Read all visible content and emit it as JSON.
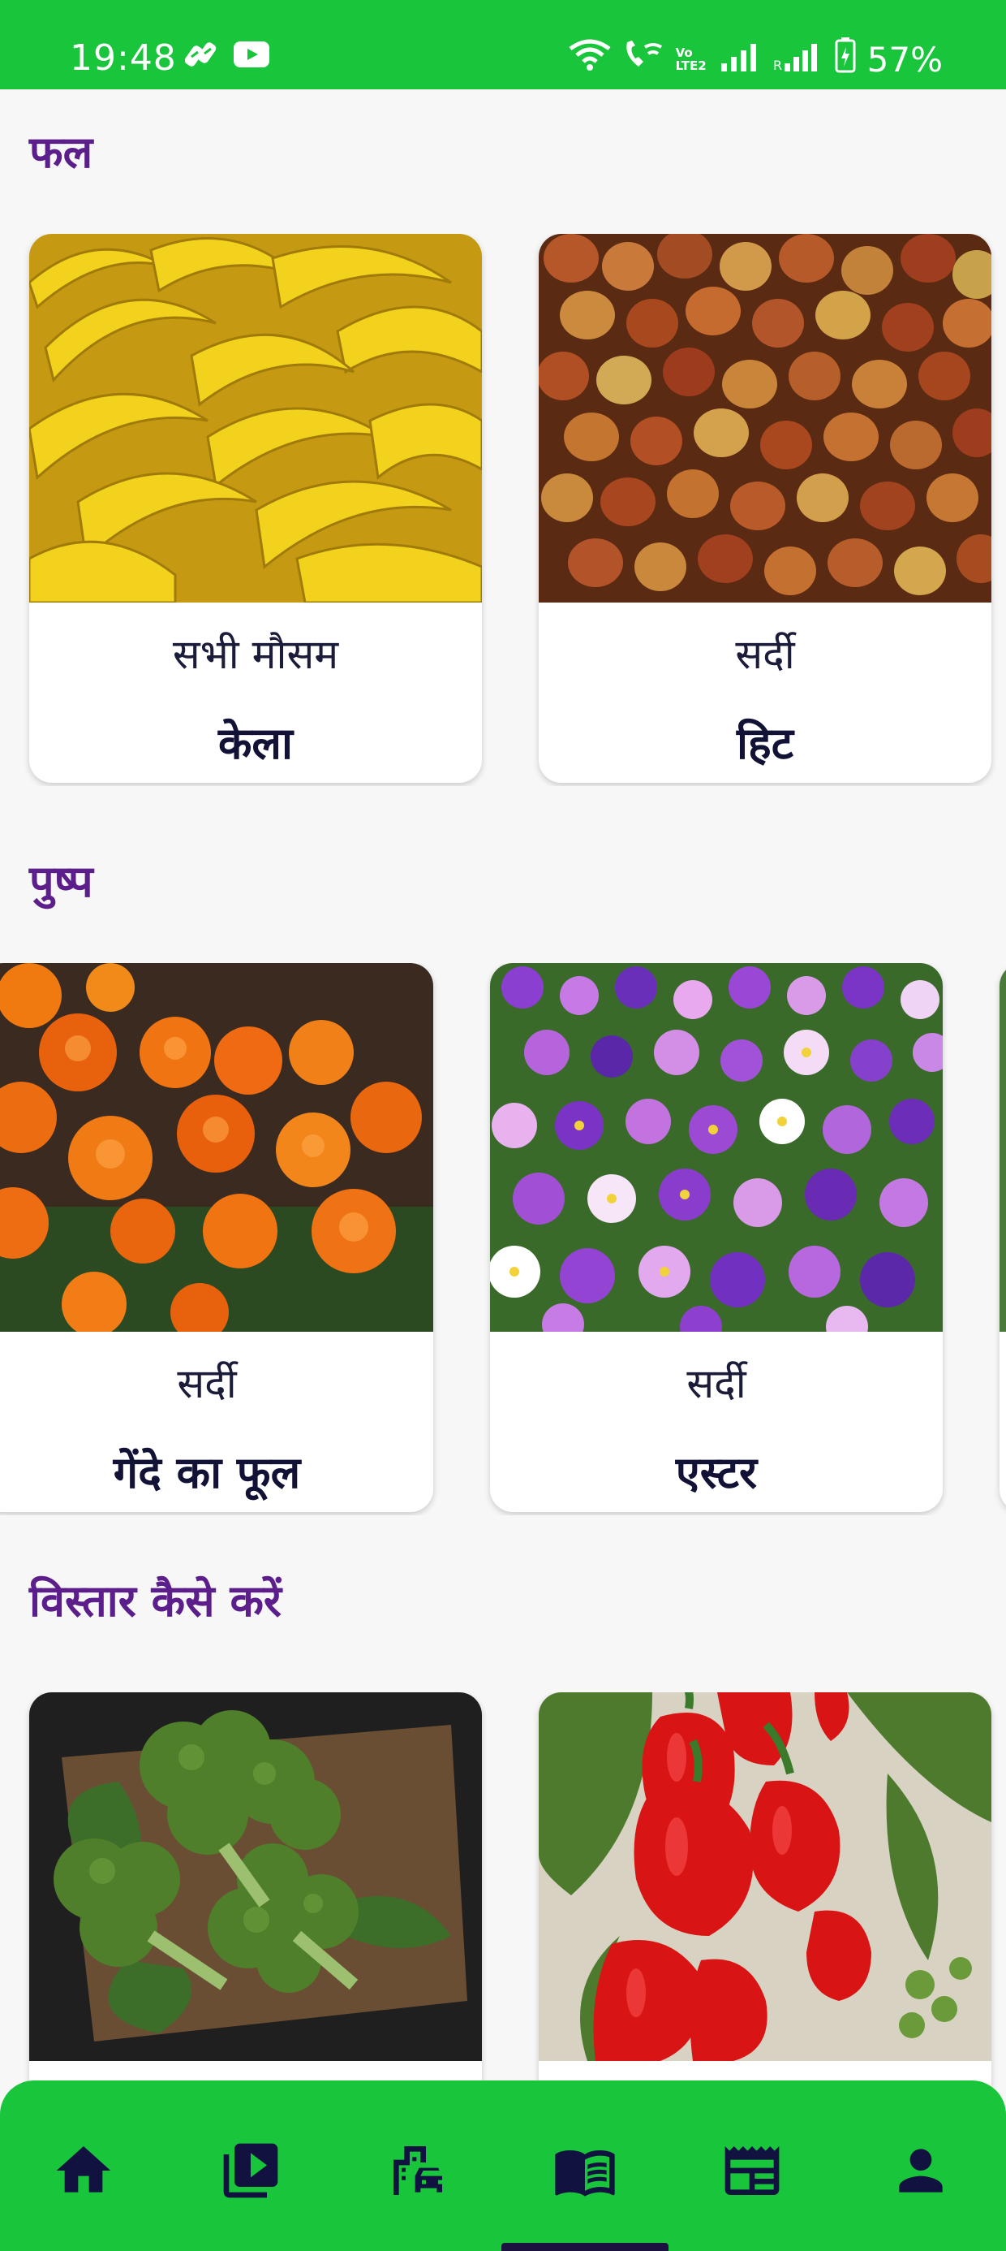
{
  "status_bar": {
    "time": "19:48",
    "battery": "57%",
    "left_icons": [
      "notification-app-icon",
      "youtube-icon"
    ],
    "right_icons": [
      "wifi-icon",
      "wifi-call-icon",
      "volte-icon",
      "signal-icon",
      "roaming-signal-icon",
      "battery-icon"
    ],
    "network_label": "Vo LTE2"
  },
  "sections": [
    {
      "title": "फल",
      "cards": [
        {
          "season": "सभी मौसम",
          "name": "केला",
          "image": "bananas"
        },
        {
          "season": "सर्दी",
          "name": "हिट",
          "image": "jujube"
        }
      ]
    },
    {
      "title": "पुष्प",
      "cards": [
        {
          "season": "सर्दी",
          "name": "गेंदे का फूल",
          "image": "marigold"
        },
        {
          "season": "सर्दी",
          "name": "एस्टर",
          "image": "aster"
        }
      ]
    },
    {
      "title": "विस्तार कैसे करें",
      "cards": [
        {
          "season": "",
          "name": "",
          "image": "broccoli"
        },
        {
          "season": "",
          "name": "",
          "image": "bell-pepper"
        }
      ]
    }
  ],
  "bottom_nav": {
    "items": [
      "home-icon",
      "video-library-icon",
      "city-car-icon",
      "book-icon",
      "newspaper-icon",
      "profile-icon"
    ],
    "active": "book-icon"
  },
  "colors": {
    "primary_green": "#19c63b",
    "section_title": "#5b1e8b",
    "dark_text": "#121236"
  }
}
